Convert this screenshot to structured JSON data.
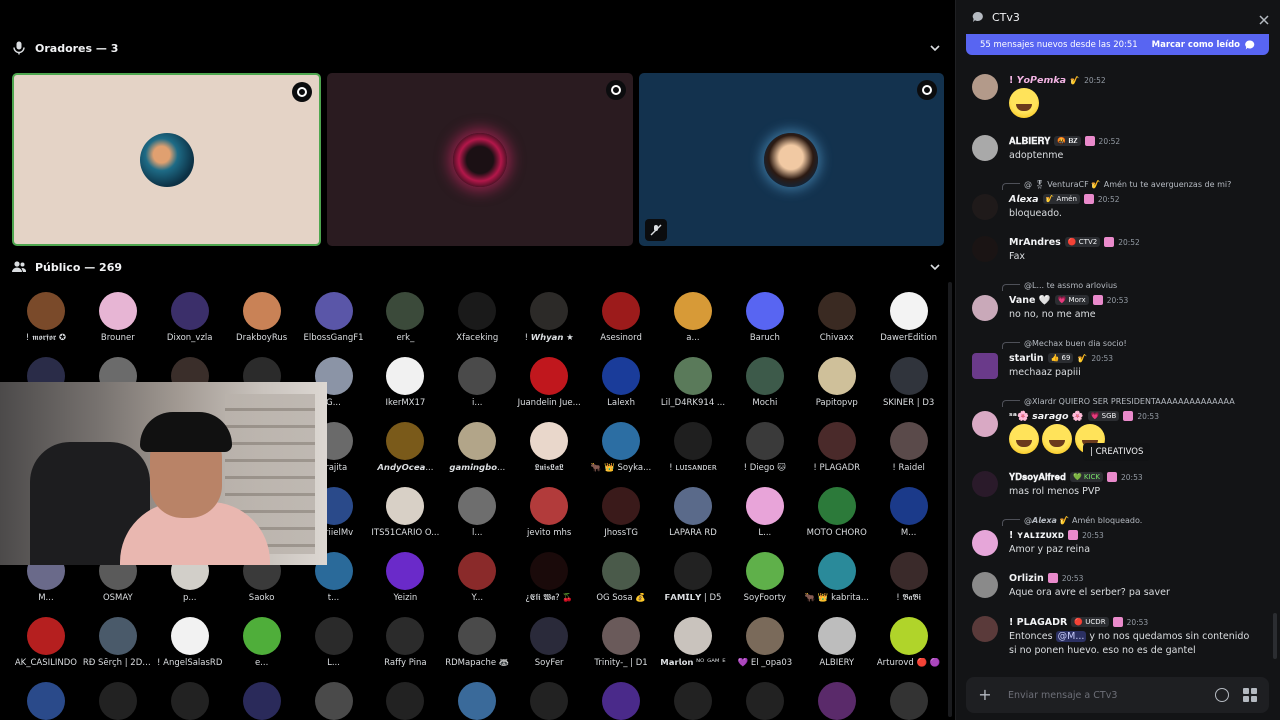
{
  "speakers": {
    "header": "Oradores — 3"
  },
  "audience": {
    "header": "Público — 269",
    "members": [
      {
        "name": "! 𝖒𝖔𝖗𝖋𝖔𝖗 ✪",
        "color": "#7a4a2a"
      },
      {
        "name": "Brouner",
        "color": "#e7b5d4"
      },
      {
        "name": "Dixon_vzla",
        "color": "#3b2f6a"
      },
      {
        "name": "DrakboyRus",
        "color": "#c98256"
      },
      {
        "name": "ElbossGangF1",
        "color": "#5a56a8"
      },
      {
        "name": "erk_",
        "color": "#3b4a3a"
      },
      {
        "name": "Xfaceking",
        "color": "#1a1a1a"
      },
      {
        "name": "! 𝙒𝙝𝙮𝙖𝙣 ★",
        "color": "#2c2a28"
      },
      {
        "name": "Asesinord",
        "color": "#9c1b1b"
      },
      {
        "name": "a...",
        "color": "#d79a37"
      },
      {
        "name": "Baruch",
        "color": "#5865f2"
      },
      {
        "name": "Chivaxx",
        "color": "#3a2a22"
      },
      {
        "name": "DawerEdition",
        "color": "#f3f3f3"
      },
      {
        "name": "",
        "color": "#2a2c48"
      },
      {
        "name": "",
        "color": "#6b6b6b"
      },
      {
        "name": "",
        "color": "#3a2e2a"
      },
      {
        "name": "",
        "color": "#2b2b2b"
      },
      {
        "name": "G...",
        "color": "#8b94a6"
      },
      {
        "name": "IkerMX17",
        "color": "#f1f1f1"
      },
      {
        "name": "i...",
        "color": "#4a4a4a"
      },
      {
        "name": "Juandelin Jue...",
        "color": "#c0171d"
      },
      {
        "name": "Lalexh",
        "color": "#1a3c9a"
      },
      {
        "name": "Lil_D4RK914 ...",
        "color": "#5a7a5a"
      },
      {
        "name": "Mochi",
        "color": "#3d5a4a"
      },
      {
        "name": "Papitopvp",
        "color": "#cfc09a"
      },
      {
        "name": "SKINER | D3",
        "color": "#30343c"
      },
      {
        "name": "",
        "color": "#222"
      },
      {
        "name": "",
        "color": "#222"
      },
      {
        "name": "",
        "color": "#222"
      },
      {
        "name": "",
        "color": "#222"
      },
      {
        "name": "..rajita",
        "color": "#6a6a6a"
      },
      {
        "name": "𝘼𝙣𝙙𝙮𝙊𝙘𝙚𝙖...",
        "color": "#7a5a1a"
      },
      {
        "name": "𝙜𝙖𝙢𝙞𝙣𝙜𝙗𝙤...",
        "color": "#b2a589"
      },
      {
        "name": "𝕷𝖚𝖎𝖘𝕷𝖆𝕷",
        "color": "#e9d7cb"
      },
      {
        "name": "🐂 👑 Soyka...",
        "color": "#2c6ea3"
      },
      {
        "name": "! ʟᴜɪsᴀɴᴅᴇʀ",
        "color": "#1f1f1f"
      },
      {
        "name": "! Diego 🐱",
        "color": "#3a3a3a"
      },
      {
        "name": "! PLAGADR",
        "color": "#4a2a2a"
      },
      {
        "name": "! Raidel",
        "color": "#5a4a4a"
      },
      {
        "name": "",
        "color": "#222"
      },
      {
        "name": "",
        "color": "#222"
      },
      {
        "name": "",
        "color": "#222"
      },
      {
        "name": "",
        "color": "#222"
      },
      {
        "name": "..BriielMv",
        "color": "#2a4a8a"
      },
      {
        "name": "ITS51CARIO O...",
        "color": "#d8d0c6"
      },
      {
        "name": "l...",
        "color": "#6e6e6e"
      },
      {
        "name": "jevito mhs",
        "color": "#b23b3b"
      },
      {
        "name": "JhossTG",
        "color": "#3a1a1a"
      },
      {
        "name": "LAPARA RD",
        "color": "#5a6a8a"
      },
      {
        "name": "L...",
        "color": "#e8a4d9"
      },
      {
        "name": "MOTO CHORO",
        "color": "#2c7a3a"
      },
      {
        "name": "M...",
        "color": "#1b3a8a"
      },
      {
        "name": "M...",
        "color": "#6a6a8a"
      },
      {
        "name": "OSMAY",
        "color": "#5a5a5a"
      },
      {
        "name": "p...",
        "color": "#d2cfc9"
      },
      {
        "name": "Saoko",
        "color": "#3a3a3a"
      },
      {
        "name": "t...",
        "color": "#2a6a9a"
      },
      {
        "name": "Yeizin",
        "color": "#6a2ac9"
      },
      {
        "name": "Y...",
        "color": "#8a2a2a"
      },
      {
        "name": "¿𝕰𝖑𝖎 𝖂𝖆? 🍒",
        "color": "#1a0a0a"
      },
      {
        "name": "OG Sosa 💰",
        "color": "#4a5a4a"
      },
      {
        "name": "𝗙𝗔𝗠𝗜𝗟𝗬 | D5",
        "color": "#222"
      },
      {
        "name": "SoyFoorty",
        "color": "#5fb04a"
      },
      {
        "name": "🐂 👑 kabrita...",
        "color": "#2a8a9a"
      },
      {
        "name": "! 𝕭𝖆𝕭𝖎",
        "color": "#3a2a2a"
      },
      {
        "name": "AK_CASILINDO",
        "color": "#b51f1f"
      },
      {
        "name": "RĐ Šērçh | 2D ...",
        "color": "#4a5a6a"
      },
      {
        "name": "! AngelSalasRD",
        "color": "#f2f2f2"
      },
      {
        "name": "e...",
        "color": "#4fae3a"
      },
      {
        "name": "L...",
        "color": "#2a2a2a"
      },
      {
        "name": "Raffy Pina",
        "color": "#2b2b2b"
      },
      {
        "name": "RDMapache 🦝",
        "color": "#4a4a4a"
      },
      {
        "name": "SoyFer",
        "color": "#2a2a3a"
      },
      {
        "name": "Trinity-_ | D1",
        "color": "#6a5a5a"
      },
      {
        "name": "𝗠𝗮𝗿𝗹𝗼𝗻 ᴺᴼ ᴳᴬᴹ ᴱ",
        "color": "#c9c3bd"
      },
      {
        "name": "💜 El _opa03",
        "color": "#7a6a5a"
      },
      {
        "name": "ALBIERY",
        "color": "#bdbdbd"
      },
      {
        "name": "Arturovd 🔴 🟣",
        "color": "#b0d42a"
      },
      {
        "name": "",
        "color": "#2a4a8a"
      },
      {
        "name": "",
        "color": "#222"
      },
      {
        "name": "",
        "color": "#222"
      },
      {
        "name": "",
        "color": "#2a2a5a"
      },
      {
        "name": "",
        "color": "#4a4a4a"
      },
      {
        "name": "",
        "color": "#222"
      },
      {
        "name": "",
        "color": "#3a6a9a"
      },
      {
        "name": "",
        "color": "#222"
      },
      {
        "name": "",
        "color": "#4a2a8a"
      },
      {
        "name": "",
        "color": "#222"
      },
      {
        "name": "",
        "color": "#222"
      },
      {
        "name": "",
        "color": "#5a2a6a"
      },
      {
        "name": "",
        "color": "#333"
      }
    ]
  },
  "chat": {
    "title": "CTv3",
    "banner_text": "55 mensajes nuevos desde las 20:51",
    "banner_action": "Marcar como leído",
    "composer_placeholder": "Enviar mensaje a CTv3",
    "tooltip": "| CREATIVOS",
    "messages": {
      "m1": {
        "author": "! 𝙔𝙤𝙋𝙚𝙢𝙠𝙖",
        "role": "🎷",
        "time": "20:52",
        "color": "#f3b4e4"
      },
      "m2": {
        "author": "𝐀𝐋𝐁𝐈𝐄𝐑𝐘",
        "role": "🤬 𝐁𝐙",
        "time": "20:52",
        "text": "adoptenme",
        "color": "#f2f3f5"
      },
      "m3": {
        "reply": "@ 🎖 VenturaCF  🎷 Amén  tu te averguenzas de mi?",
        "author": "𝘼𝙡𝙚𝙭𝙖",
        "role": "🎷 Amén",
        "time": "20:52",
        "text": "bloqueado.",
        "color": "#f2f3f5"
      },
      "m4": {
        "author": "MrAndres",
        "role": "🔴 CTV2",
        "time": "20:52",
        "text": "Fax",
        "color": "#f2f3f5"
      },
      "m5": {
        "reply": "@L... te assmo arlovius",
        "author": "Vane 🤍",
        "role": "💗 Morx",
        "time": "20:53",
        "text": "no no, no me ame",
        "color": "#f2f3f5"
      },
      "m6": {
        "reply": "@Mechax buen dia socio!",
        "author": "𝘀𝘁𝗮𝗿𝗹𝗶𝗻",
        "role": "👍 69",
        "time": "20:53",
        "text": "mechaaz papiii",
        "color": "#f2f3f5"
      },
      "m7": {
        "reply": "@Xlardr QUIERO SER PRESIDENTAAAAAAAAAAAAAA",
        "author": "ˢᵃ🌸 𝙨𝙖𝙧𝙖𝙜𝙤 🌸",
        "role": "💗 SGB",
        "time": "20:53",
        "color": "#f2f3f5"
      },
      "m8": {
        "author": "𝐘𝐃𝐬𝐨𝐲𝐀𝐥𝐟𝐫𝐞𝐝",
        "role": "💚 KICK",
        "time": "20:53",
        "text": "mas rol menos PVP",
        "color": "#f2f3f5"
      },
      "m9": {
        "reply": "@𝘼𝙡𝙚𝙭𝙖  🎷 Amén  bloqueado.",
        "author": "! ʏᴀʟɪᴢᴜxᴅ",
        "time": "20:53",
        "text": "Amor y paz reina",
        "color": "#f2f3f5"
      },
      "m10": {
        "author": "Orlizin",
        "time": "20:53",
        "text": "Aque ora avre el serber? pa saver",
        "color": "#f2f3f5"
      },
      "m11": {
        "author": "! PLAGADR",
        "role": "🔴 UCDR",
        "time": "20:53",
        "text_pre": "Entonces ",
        "mention": "@M...",
        "text_post": " y no nos quedamos sin contenido si no ponen huevo. eso no es de gantel",
        "color": "#f2f3f5"
      }
    }
  },
  "colors": {
    "accent": "#5865f2",
    "speaking": "#4ea64f",
    "chat_bg": "#131416"
  }
}
